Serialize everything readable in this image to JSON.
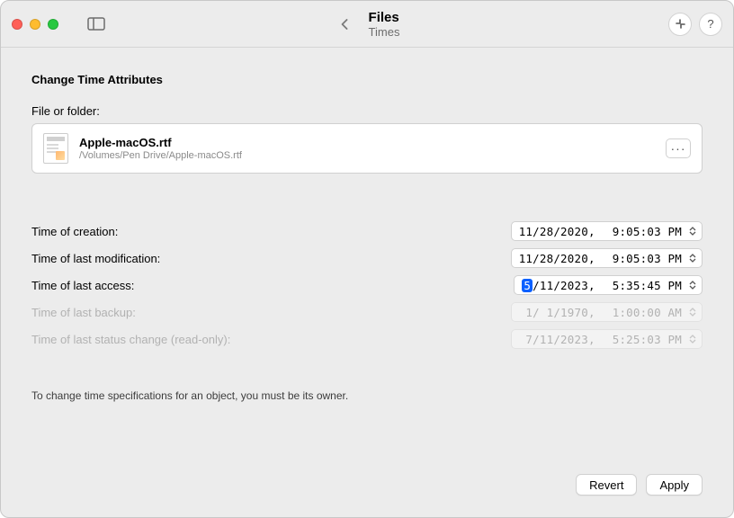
{
  "titlebar": {
    "title": "Files",
    "subtitle": "Times"
  },
  "section": {
    "heading": "Change Time Attributes",
    "file_or_folder_label": "File or folder:"
  },
  "file": {
    "name": "Apple-macOS.rtf",
    "path": "/Volumes/Pen Drive/Apple-macOS.rtf"
  },
  "rows": {
    "creation": {
      "label": "Time of creation:",
      "date": "11/28/2020,",
      "time": "9:05:03 PM",
      "disabled": false
    },
    "modification": {
      "label": "Time of last modification:",
      "date": "11/28/2020,",
      "time": "9:05:03 PM",
      "disabled": false
    },
    "access": {
      "label": "Time of last access:",
      "date_prefix_sel": "5",
      "date_rest": "/11/2023,",
      "time": "5:35:45 PM",
      "disabled": false
    },
    "backup": {
      "label": "Time of last backup:",
      "date": " 1/ 1/1970,",
      "time": "1:00:00 AM",
      "disabled": true
    },
    "status": {
      "label": "Time of last status change (read-only):",
      "date": " 7/11/2023,",
      "time": "5:25:03 PM",
      "disabled": true
    }
  },
  "note": "To change time specifications for an object, you must be its owner.",
  "buttons": {
    "revert": "Revert",
    "apply": "Apply",
    "help": "?",
    "more": "···"
  }
}
